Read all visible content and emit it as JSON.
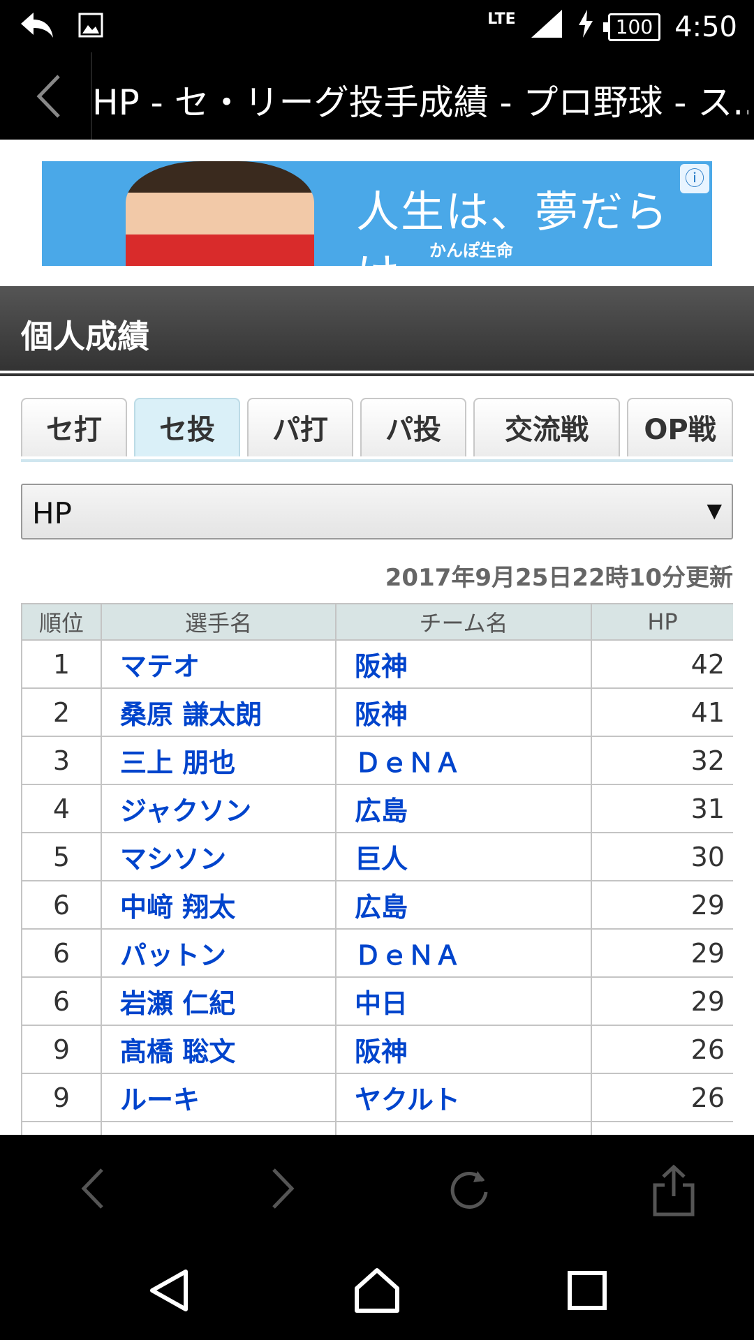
{
  "status_bar": {
    "network": "LTE",
    "battery": "100",
    "time": "4:50"
  },
  "title_bar": {
    "title": "HP - セ・リーグ投手成績 - プロ野球 - ス..."
  },
  "ad": {
    "slogan": "人生は、夢だらけ。",
    "brand": "かんぽ生命"
  },
  "section": {
    "title": "個人成績"
  },
  "tabs": [
    {
      "label": "セ打"
    },
    {
      "label": "セ投"
    },
    {
      "label": "パ打"
    },
    {
      "label": "パ投"
    },
    {
      "label": "交流戦"
    },
    {
      "label": "OP戦"
    }
  ],
  "dropdown": {
    "selected": "HP"
  },
  "updated_text": "2017年9月25日22時10分更新",
  "table": {
    "headers": [
      "順位",
      "選手名",
      "チーム名",
      "HP"
    ],
    "rows": [
      {
        "rank": "1",
        "name": "マテオ",
        "team": "阪神",
        "value": "42"
      },
      {
        "rank": "2",
        "name": "桑原 謙太朗",
        "team": "阪神",
        "value": "41"
      },
      {
        "rank": "3",
        "name": "三上 朋也",
        "team": "ＤｅＮＡ",
        "value": "32"
      },
      {
        "rank": "4",
        "name": "ジャクソン",
        "team": "広島",
        "value": "31"
      },
      {
        "rank": "5",
        "name": "マシソン",
        "team": "巨人",
        "value": "30"
      },
      {
        "rank": "6",
        "name": "中﨑 翔太",
        "team": "広島",
        "value": "29"
      },
      {
        "rank": "6",
        "name": "パットン",
        "team": "ＤｅＮＡ",
        "value": "29"
      },
      {
        "rank": "6",
        "name": "岩瀬 仁紀",
        "team": "中日",
        "value": "29"
      },
      {
        "rank": "9",
        "name": "髙橋 聡文",
        "team": "阪神",
        "value": "26"
      },
      {
        "rank": "9",
        "name": "ルーキ",
        "team": "ヤクルト",
        "value": "26"
      }
    ]
  },
  "icons": {
    "status_left": [
      "reply-icon",
      "image-icon"
    ],
    "browser_nav": [
      "back-icon",
      "forward-icon",
      "reload-icon",
      "share-icon"
    ],
    "system_nav": [
      "back-triangle-icon",
      "home-icon",
      "recents-icon"
    ]
  }
}
